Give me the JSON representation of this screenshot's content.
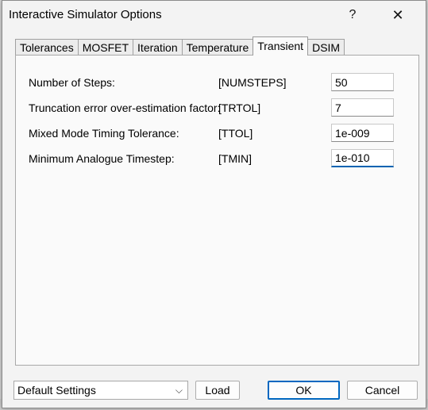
{
  "window": {
    "title": "Interactive Simulator Options",
    "help_label": "?",
    "close_label": "✕"
  },
  "tabs": [
    {
      "label": "Tolerances",
      "active": false
    },
    {
      "label": "MOSFET",
      "active": false
    },
    {
      "label": "Iteration",
      "active": false
    },
    {
      "label": "Temperature",
      "active": false
    },
    {
      "label": "Transient",
      "active": true
    },
    {
      "label": "DSIM",
      "active": false
    }
  ],
  "transient": {
    "rows": [
      {
        "label": "Number of Steps:",
        "key": "[NUMSTEPS]",
        "value": "50"
      },
      {
        "label": "Truncation error over-estimation factor:",
        "key": "[TRTOL]",
        "value": "7"
      },
      {
        "label": "Mixed Mode Timing Tolerance:",
        "key": "[TTOL]",
        "value": "1e-009"
      },
      {
        "label": "Minimum Analogue Timestep:",
        "key": "[TMIN]",
        "value": "1e-010"
      }
    ]
  },
  "footer": {
    "preset_value": "Default Settings",
    "load_label": "Load",
    "ok_label": "OK",
    "cancel_label": "Cancel"
  },
  "colors": {
    "accent": "#0067c0",
    "panel_bg": "#fafafa",
    "dialog_bg": "#f3f3f3"
  }
}
